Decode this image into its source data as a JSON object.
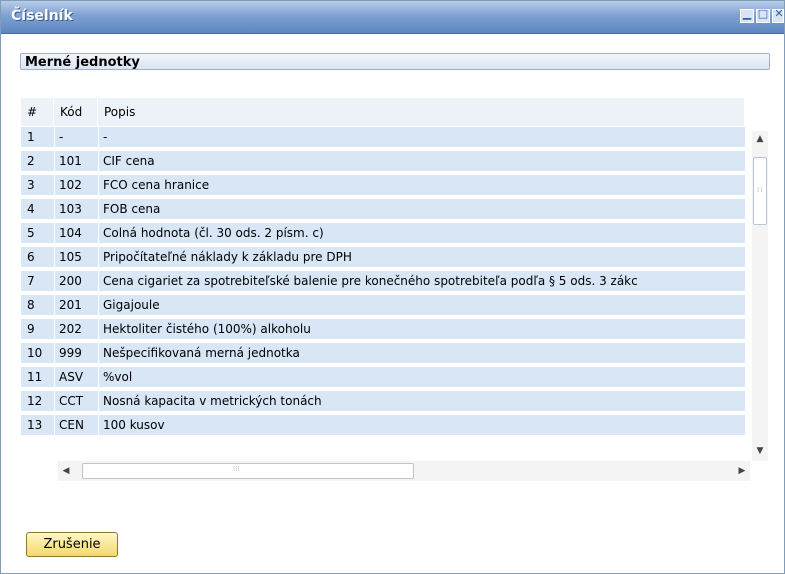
{
  "window": {
    "title": "Číselník",
    "controls": [
      "minimize-icon",
      "maximize-icon",
      "close-icon"
    ]
  },
  "header": {
    "value": "Merné jednotky"
  },
  "grid": {
    "columns": [
      "#",
      "Kód",
      "Popis"
    ],
    "rows": [
      {
        "num": "1",
        "kod": "-",
        "popis": "-"
      },
      {
        "num": "2",
        "kod": "101",
        "popis": "CIF cena"
      },
      {
        "num": "3",
        "kod": "102",
        "popis": "FCO cena hranice"
      },
      {
        "num": "4",
        "kod": "103",
        "popis": "FOB cena"
      },
      {
        "num": "5",
        "kod": "104",
        "popis": "Colná hodnota (čl. 30 ods. 2 písm. c)"
      },
      {
        "num": "6",
        "kod": "105",
        "popis": "Pripočítateľné náklady k základu pre DPH"
      },
      {
        "num": "7",
        "kod": "200",
        "popis": "Cena cigariet za spotrebiteľské balenie pre konečného spotrebiteľa podľa § 5 ods. 3 zákc"
      },
      {
        "num": "8",
        "kod": "201",
        "popis": "Gigajoule"
      },
      {
        "num": "9",
        "kod": "202",
        "popis": "Hektoliter čistého (100%) alkoholu"
      },
      {
        "num": "10",
        "kod": "999",
        "popis": "Nešpecifikovaná merná jednotka"
      },
      {
        "num": "11",
        "kod": "ASV",
        "popis": "%vol"
      },
      {
        "num": "12",
        "kod": "CCT",
        "popis": "Nosná kapacita v metrických tonách"
      },
      {
        "num": "13",
        "kod": "CEN",
        "popis": "100 kusov"
      }
    ]
  },
  "buttons": {
    "cancel": "Zrušenie"
  },
  "colors": {
    "titlebar": "#6f93cb",
    "row_bg": "#d8e6f6",
    "button": "#f3d86a"
  }
}
